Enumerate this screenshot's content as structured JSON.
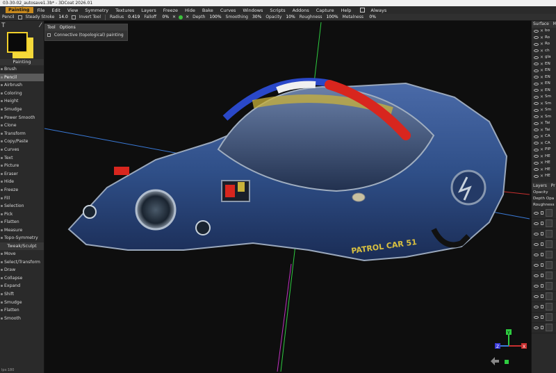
{
  "title": "03-30-02_autosave1.3b* - 3DCoat 2026.01",
  "menubar": {
    "workspace": "Painting",
    "items": [
      "File",
      "Edit",
      "View",
      "Symmetry",
      "Textures",
      "Layers",
      "Freeze",
      "Hide",
      "Bake",
      "Curves",
      "Windows",
      "Scripts",
      "Addons",
      "Capture",
      "Help"
    ],
    "always_label": "Always"
  },
  "toolbar": {
    "tool": "Pencil",
    "steady_label": "Steady Stroke",
    "steady_value": "14.0",
    "invert_label": "Invert Tool",
    "radius_label": "Radius",
    "radius_value": "0.419",
    "falloff_label": "Falloff",
    "falloff_value": "0%",
    "depth_label": "Depth",
    "depth_value": "100%",
    "smoothing_label": "Smoothing",
    "smoothing_value": "30%",
    "opacity_label": "Opacity",
    "opacity_value": "10%",
    "roughness_label": "Roughness",
    "roughness_value": "100%",
    "metalness_label": "Metalness",
    "metalness_value": "0%"
  },
  "tool_options": {
    "tab1": "Tool",
    "tab2": "Options",
    "option": "Connective (topological) painting"
  },
  "left_panel": {
    "painting_label": "Painting",
    "tools": [
      "Brush",
      "Pencil",
      "Airbrush",
      "Coloring",
      "Height",
      "Smudge",
      "Power Smooth",
      "Clone",
      "Transform",
      "Copy/Paste",
      "Curves",
      "Text",
      "Picture",
      "Eraser",
      "Hide",
      "Freeze",
      "Fill",
      "Selection",
      "Pick",
      "Flatten",
      "Measure",
      "Topo-Symmetry"
    ],
    "selected_tool": "Pencil",
    "section2": "Tweak/Sculpt",
    "tweak_tools": [
      "Move",
      "Select/Transform",
      "Draw",
      "Collapse",
      "Expand",
      "Shift",
      "Smudge",
      "Flatten",
      "Smooth"
    ],
    "status": "lps:180"
  },
  "viewport": {
    "decal_text": "PATROL CAR 51",
    "axis_y": "Y",
    "axis_x": "X",
    "axis_z": "Z"
  },
  "right_panel": {
    "tab_surface": "Surface",
    "tab_materials": "Ma",
    "surfaces": [
      "bo",
      "Ro",
      "Ro",
      "ch",
      "gla",
      "EN",
      "EN",
      "EN",
      "EN",
      "EN",
      "Sm",
      "Sm",
      "Sm",
      "Sm",
      "Tai",
      "Tai",
      "CA",
      "CA",
      "PIP",
      "HE",
      "HE",
      "HE",
      "HE"
    ],
    "tab_layers": "Layers",
    "tab_props": "Pr",
    "layer_props": [
      "Opacity",
      "Depth  Opa",
      "Roughness"
    ],
    "layer_count": 12
  },
  "colors": {
    "accent": "#c98a1e",
    "primary_swatch": "#0a0a0a",
    "secondary_swatch": "#f4d93a",
    "car_body": "#2f4f88",
    "car_stripe_red": "#d8261e",
    "car_stripe_yellow": "#c9b23a"
  }
}
